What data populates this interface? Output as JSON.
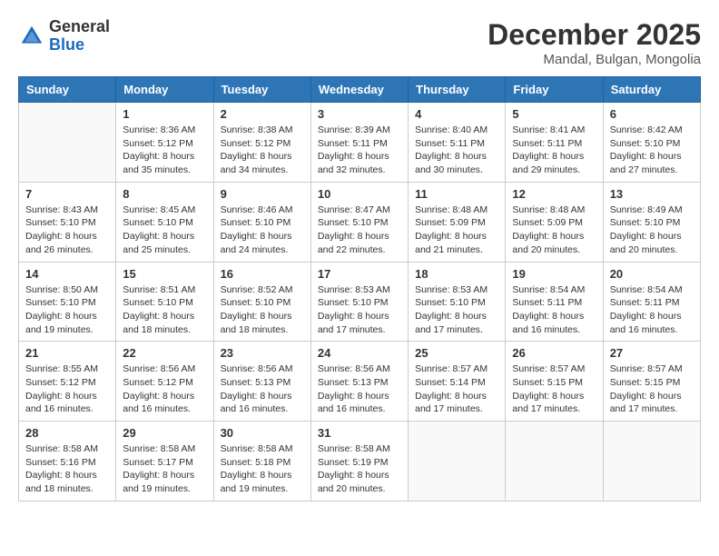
{
  "header": {
    "logo_general": "General",
    "logo_blue": "Blue",
    "month_title": "December 2025",
    "location": "Mandal, Bulgan, Mongolia"
  },
  "weekdays": [
    "Sunday",
    "Monday",
    "Tuesday",
    "Wednesday",
    "Thursday",
    "Friday",
    "Saturday"
  ],
  "weeks": [
    [
      {
        "day": "",
        "info": ""
      },
      {
        "day": "1",
        "info": "Sunrise: 8:36 AM\nSunset: 5:12 PM\nDaylight: 8 hours\nand 35 minutes."
      },
      {
        "day": "2",
        "info": "Sunrise: 8:38 AM\nSunset: 5:12 PM\nDaylight: 8 hours\nand 34 minutes."
      },
      {
        "day": "3",
        "info": "Sunrise: 8:39 AM\nSunset: 5:11 PM\nDaylight: 8 hours\nand 32 minutes."
      },
      {
        "day": "4",
        "info": "Sunrise: 8:40 AM\nSunset: 5:11 PM\nDaylight: 8 hours\nand 30 minutes."
      },
      {
        "day": "5",
        "info": "Sunrise: 8:41 AM\nSunset: 5:11 PM\nDaylight: 8 hours\nand 29 minutes."
      },
      {
        "day": "6",
        "info": "Sunrise: 8:42 AM\nSunset: 5:10 PM\nDaylight: 8 hours\nand 27 minutes."
      }
    ],
    [
      {
        "day": "7",
        "info": "Sunrise: 8:43 AM\nSunset: 5:10 PM\nDaylight: 8 hours\nand 26 minutes."
      },
      {
        "day": "8",
        "info": "Sunrise: 8:45 AM\nSunset: 5:10 PM\nDaylight: 8 hours\nand 25 minutes."
      },
      {
        "day": "9",
        "info": "Sunrise: 8:46 AM\nSunset: 5:10 PM\nDaylight: 8 hours\nand 24 minutes."
      },
      {
        "day": "10",
        "info": "Sunrise: 8:47 AM\nSunset: 5:10 PM\nDaylight: 8 hours\nand 22 minutes."
      },
      {
        "day": "11",
        "info": "Sunrise: 8:48 AM\nSunset: 5:09 PM\nDaylight: 8 hours\nand 21 minutes."
      },
      {
        "day": "12",
        "info": "Sunrise: 8:48 AM\nSunset: 5:09 PM\nDaylight: 8 hours\nand 20 minutes."
      },
      {
        "day": "13",
        "info": "Sunrise: 8:49 AM\nSunset: 5:10 PM\nDaylight: 8 hours\nand 20 minutes."
      }
    ],
    [
      {
        "day": "14",
        "info": "Sunrise: 8:50 AM\nSunset: 5:10 PM\nDaylight: 8 hours\nand 19 minutes."
      },
      {
        "day": "15",
        "info": "Sunrise: 8:51 AM\nSunset: 5:10 PM\nDaylight: 8 hours\nand 18 minutes."
      },
      {
        "day": "16",
        "info": "Sunrise: 8:52 AM\nSunset: 5:10 PM\nDaylight: 8 hours\nand 18 minutes."
      },
      {
        "day": "17",
        "info": "Sunrise: 8:53 AM\nSunset: 5:10 PM\nDaylight: 8 hours\nand 17 minutes."
      },
      {
        "day": "18",
        "info": "Sunrise: 8:53 AM\nSunset: 5:10 PM\nDaylight: 8 hours\nand 17 minutes."
      },
      {
        "day": "19",
        "info": "Sunrise: 8:54 AM\nSunset: 5:11 PM\nDaylight: 8 hours\nand 16 minutes."
      },
      {
        "day": "20",
        "info": "Sunrise: 8:54 AM\nSunset: 5:11 PM\nDaylight: 8 hours\nand 16 minutes."
      }
    ],
    [
      {
        "day": "21",
        "info": "Sunrise: 8:55 AM\nSunset: 5:12 PM\nDaylight: 8 hours\nand 16 minutes."
      },
      {
        "day": "22",
        "info": "Sunrise: 8:56 AM\nSunset: 5:12 PM\nDaylight: 8 hours\nand 16 minutes."
      },
      {
        "day": "23",
        "info": "Sunrise: 8:56 AM\nSunset: 5:13 PM\nDaylight: 8 hours\nand 16 minutes."
      },
      {
        "day": "24",
        "info": "Sunrise: 8:56 AM\nSunset: 5:13 PM\nDaylight: 8 hours\nand 16 minutes."
      },
      {
        "day": "25",
        "info": "Sunrise: 8:57 AM\nSunset: 5:14 PM\nDaylight: 8 hours\nand 17 minutes."
      },
      {
        "day": "26",
        "info": "Sunrise: 8:57 AM\nSunset: 5:15 PM\nDaylight: 8 hours\nand 17 minutes."
      },
      {
        "day": "27",
        "info": "Sunrise: 8:57 AM\nSunset: 5:15 PM\nDaylight: 8 hours\nand 17 minutes."
      }
    ],
    [
      {
        "day": "28",
        "info": "Sunrise: 8:58 AM\nSunset: 5:16 PM\nDaylight: 8 hours\nand 18 minutes."
      },
      {
        "day": "29",
        "info": "Sunrise: 8:58 AM\nSunset: 5:17 PM\nDaylight: 8 hours\nand 19 minutes."
      },
      {
        "day": "30",
        "info": "Sunrise: 8:58 AM\nSunset: 5:18 PM\nDaylight: 8 hours\nand 19 minutes."
      },
      {
        "day": "31",
        "info": "Sunrise: 8:58 AM\nSunset: 5:19 PM\nDaylight: 8 hours\nand 20 minutes."
      },
      {
        "day": "",
        "info": ""
      },
      {
        "day": "",
        "info": ""
      },
      {
        "day": "",
        "info": ""
      }
    ]
  ]
}
